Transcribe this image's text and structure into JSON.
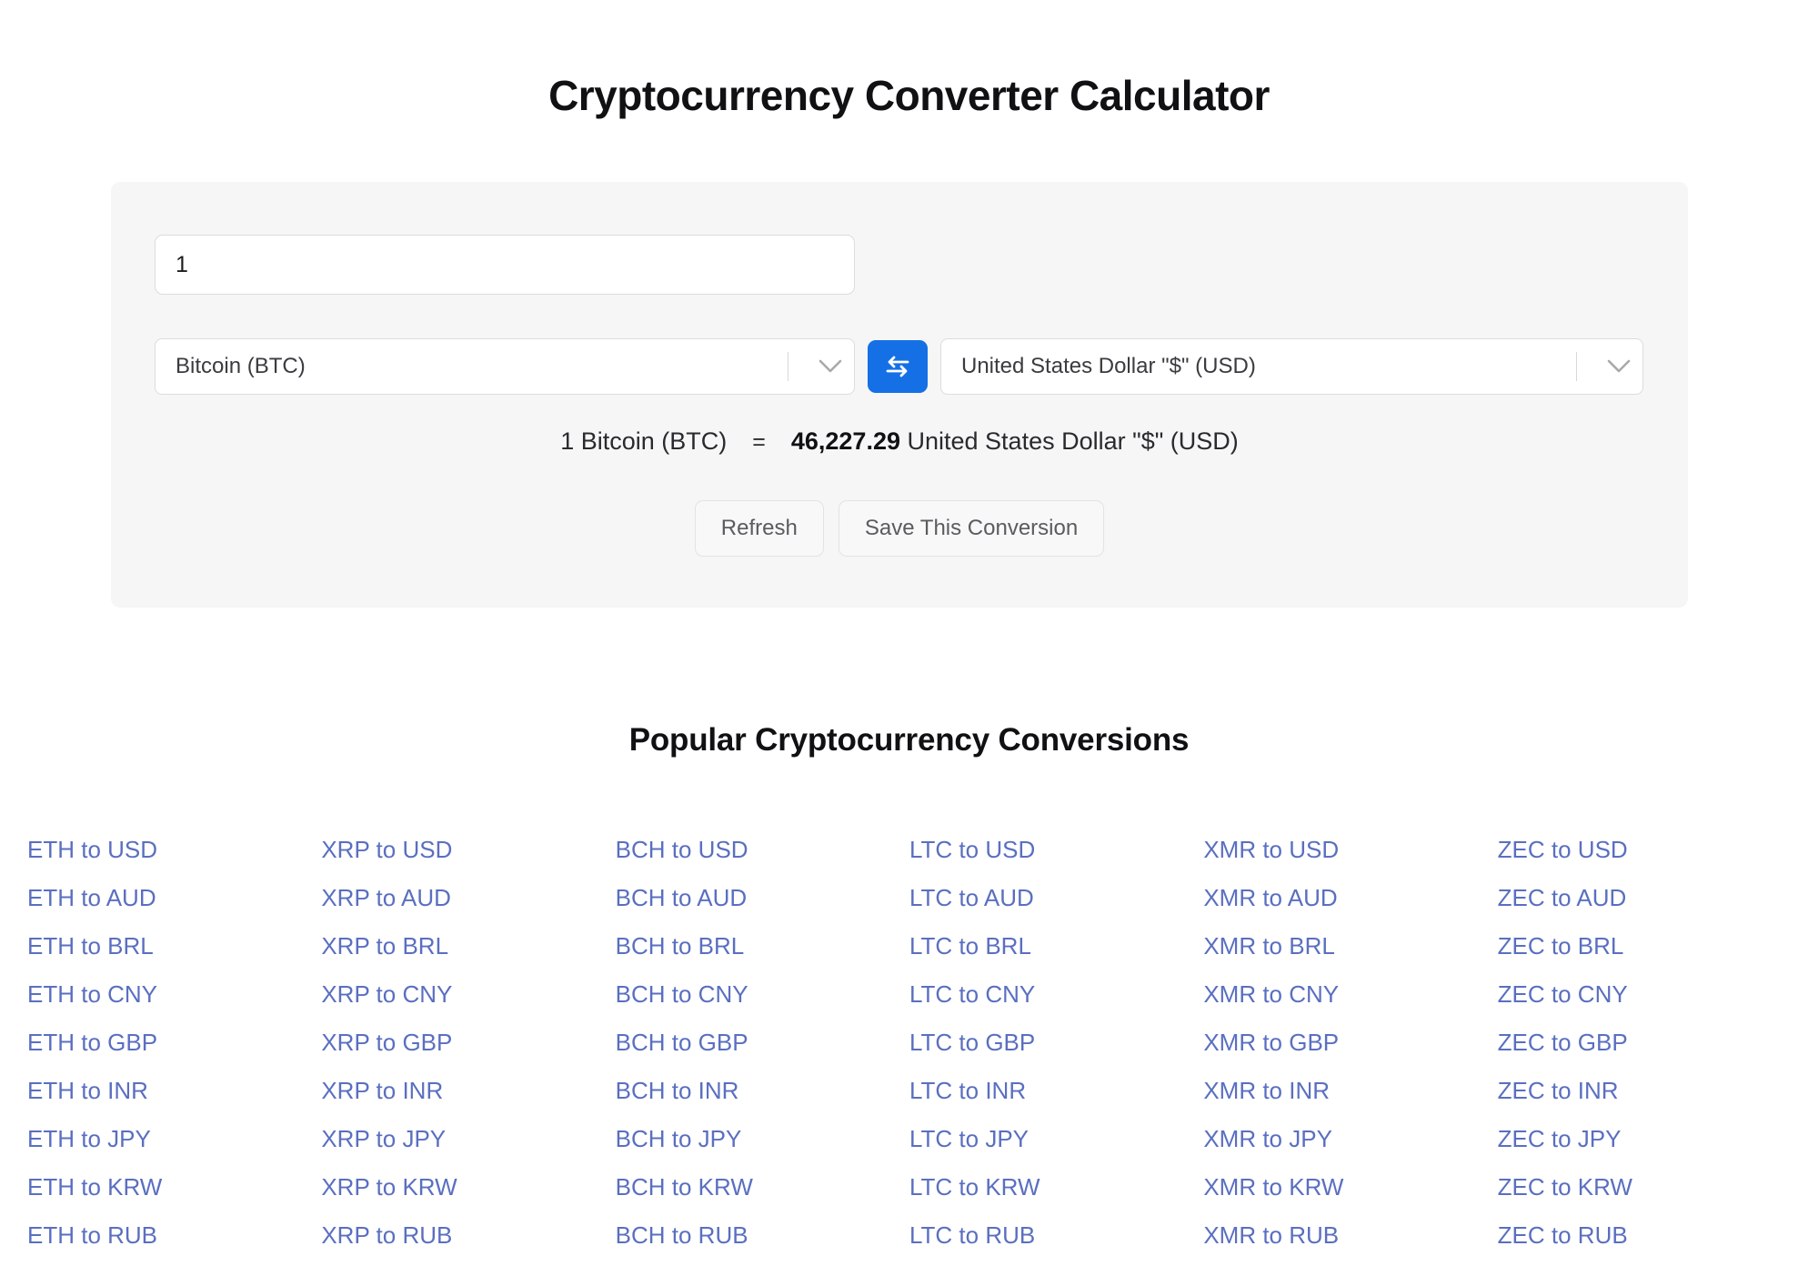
{
  "page": {
    "title": "Cryptocurrency Converter Calculator"
  },
  "converter": {
    "amount_input": {
      "value": "1",
      "placeholder": "Enter amount"
    },
    "from_select": {
      "value": "Bitcoin (BTC)",
      "chevron_icon": "chevron-down-icon"
    },
    "swap_button": {
      "icon": "swap-arrows-icon",
      "color": "#1570e6"
    },
    "to_select": {
      "value": "United States Dollar \"$\" (USD)",
      "chevron_icon": "chevron-down-icon"
    },
    "result": {
      "left": "1 Bitcoin (BTC)",
      "equals": "=",
      "amount": "46,227.29",
      "unit": "United States Dollar \"$\" (USD)"
    },
    "refresh_label": "Refresh",
    "save_label": "Save This Conversion",
    "panel_color": "#f6f6f7"
  },
  "popular": {
    "heading": "Popular Cryptocurrency Conversions",
    "link_color": "#5a6fc0",
    "columns": [
      {
        "base": "ETH",
        "links": [
          "ETH to USD",
          "ETH to AUD",
          "ETH to BRL",
          "ETH to CNY",
          "ETH to GBP",
          "ETH to INR",
          "ETH to JPY",
          "ETH to KRW",
          "ETH to RUB"
        ]
      },
      {
        "base": "XRP",
        "links": [
          "XRP to USD",
          "XRP to AUD",
          "XRP to BRL",
          "XRP to CNY",
          "XRP to GBP",
          "XRP to INR",
          "XRP to JPY",
          "XRP to KRW",
          "XRP to RUB"
        ]
      },
      {
        "base": "BCH",
        "links": [
          "BCH to USD",
          "BCH to AUD",
          "BCH to BRL",
          "BCH to CNY",
          "BCH to GBP",
          "BCH to INR",
          "BCH to JPY",
          "BCH to KRW",
          "BCH to RUB"
        ]
      },
      {
        "base": "LTC",
        "links": [
          "LTC to USD",
          "LTC to AUD",
          "LTC to BRL",
          "LTC to CNY",
          "LTC to GBP",
          "LTC to INR",
          "LTC to JPY",
          "LTC to KRW",
          "LTC to RUB"
        ]
      },
      {
        "base": "XMR",
        "links": [
          "XMR to USD",
          "XMR to AUD",
          "XMR to BRL",
          "XMR to CNY",
          "XMR to GBP",
          "XMR to INR",
          "XMR to JPY",
          "XMR to KRW",
          "XMR to RUB"
        ]
      },
      {
        "base": "ZEC",
        "links": [
          "ZEC to USD",
          "ZEC to AUD",
          "ZEC to BRL",
          "ZEC to CNY",
          "ZEC to GBP",
          "ZEC to INR",
          "ZEC to JPY",
          "ZEC to KRW",
          "ZEC to RUB"
        ]
      }
    ]
  }
}
